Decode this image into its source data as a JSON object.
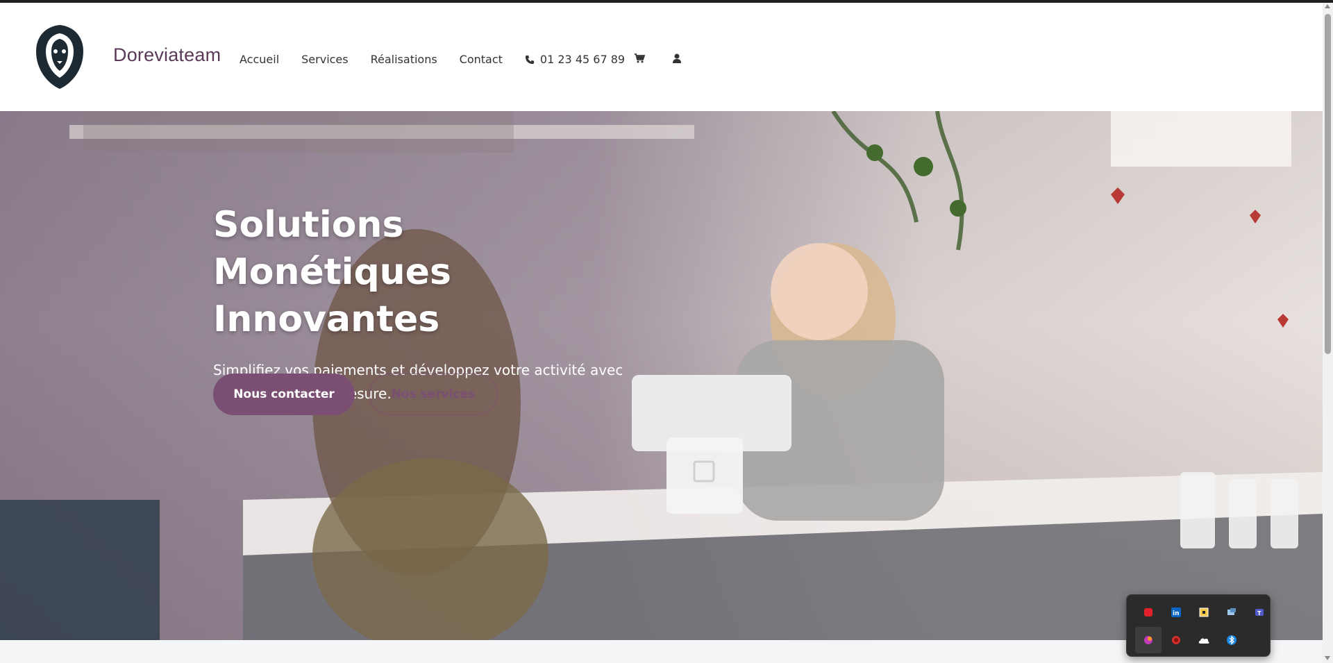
{
  "header": {
    "brand": "Doreviateam",
    "nav": [
      {
        "label": "Accueil"
      },
      {
        "label": "Services"
      },
      {
        "label": "Réalisations"
      },
      {
        "label": "Contact"
      }
    ],
    "phone": "01 23 45 67 89",
    "icons": [
      "logo-lion-icon",
      "phone-icon",
      "cart-icon",
      "user-icon"
    ]
  },
  "hero": {
    "title_line1": "Solutions Monétiques",
    "title_line2": "Innovantes",
    "subtitle": "Simplifiez vos paiements et développez votre activité avec nos solutions sur mesure.",
    "cta_primary": "Nous contacter",
    "cta_secondary": "Nos services"
  },
  "tray": {
    "icons": [
      "red-app-icon",
      "linkedin-icon",
      "sticky-notes-icon",
      "network-icon",
      "teams-icon",
      "color-app-icon",
      "record-icon",
      "onedrive-icon",
      "bluetooth-icon"
    ]
  },
  "colors": {
    "brand": "#5a3a59",
    "primary_button": "#7a4f73",
    "text_dark": "#333333"
  }
}
